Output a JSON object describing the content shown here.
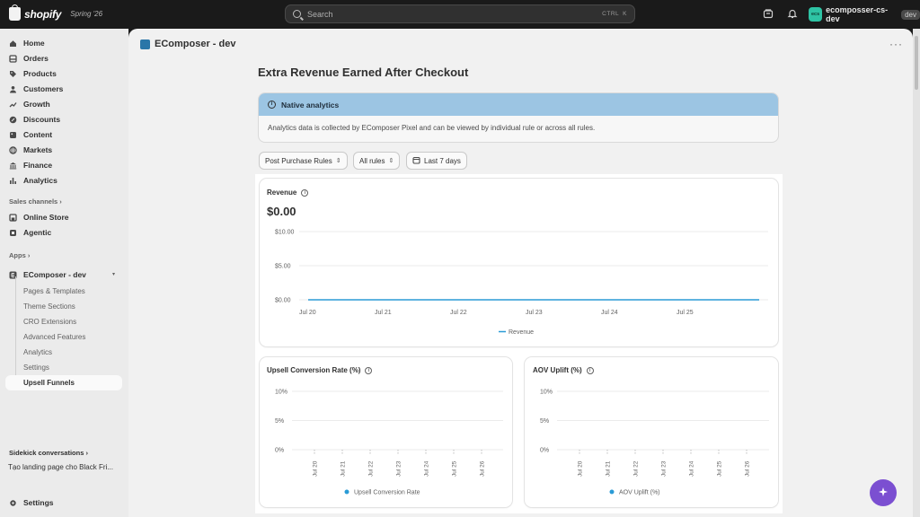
{
  "topbar": {
    "brand": "shopify",
    "edition": "Spring '26",
    "search_placeholder": "Search",
    "shortcut_ctrl": "CTRL",
    "shortcut_key": "K",
    "store_initials": "ecs",
    "store_name": "ecomposser-cs-dev",
    "store_badge": "dev"
  },
  "sidebar": {
    "items": [
      {
        "label": "Home",
        "icon": "home-icon"
      },
      {
        "label": "Orders",
        "icon": "orders-icon"
      },
      {
        "label": "Products",
        "icon": "tag-icon"
      },
      {
        "label": "Customers",
        "icon": "person-icon"
      },
      {
        "label": "Growth",
        "icon": "growth-icon"
      },
      {
        "label": "Discounts",
        "icon": "discount-icon"
      },
      {
        "label": "Content",
        "icon": "content-icon"
      },
      {
        "label": "Markets",
        "icon": "globe-icon"
      },
      {
        "label": "Finance",
        "icon": "bank-icon"
      },
      {
        "label": "Analytics",
        "icon": "bar-chart-icon"
      }
    ],
    "sales_channels_label": "Sales channels",
    "channels": [
      {
        "label": "Online Store"
      },
      {
        "label": "Agentic"
      }
    ],
    "apps_label": "Apps",
    "app_name": "EComposer - dev",
    "app_sub_items": [
      "Pages & Templates",
      "Theme Sections",
      "CRO Extensions",
      "Advanced Features",
      "Analytics",
      "Settings"
    ],
    "active_sub_item": "Upsell Funnels",
    "sidekick_label": "Sidekick conversations",
    "sidekick_item": "Tạo landing page cho Black Fri...",
    "settings_label": "Settings"
  },
  "header": {
    "app_title": "EComposer - dev",
    "more": "···"
  },
  "page": {
    "title": "Extra Revenue Earned After Checkout",
    "banner_title": "Native analytics",
    "banner_text": "Analytics data is collected by EComposer Pixel and can be viewed by individual rule or across all rules.",
    "filters": {
      "rule_type": "Post Purchase Rules",
      "rules": "All rules",
      "date_range": "Last 7 days"
    }
  },
  "chart_data": [
    {
      "type": "line",
      "title": "Revenue",
      "total": "$0.00",
      "categories": [
        "Jul 20",
        "Jul 21",
        "Jul 22",
        "Jul 23",
        "Jul 24",
        "Jul 25"
      ],
      "y_ticks": [
        "$10.00",
        "$5.00",
        "$0.00"
      ],
      "ylim": [
        0,
        10
      ],
      "series": [
        {
          "name": "Revenue",
          "values": [
            0,
            0,
            0,
            0,
            0,
            0,
            0
          ]
        }
      ],
      "color": "#2a9bd6",
      "legend": "bottom",
      "grid": true
    },
    {
      "type": "line",
      "title": "Upsell Conversion Rate (%)",
      "categories": [
        "Jul 20",
        "Jul 21",
        "Jul 22",
        "Jul 23",
        "Jul 24",
        "Jul 25",
        "Jul 26"
      ],
      "y_ticks": [
        "10%",
        "5%",
        "0%"
      ],
      "ylim": [
        0,
        10
      ],
      "series": [
        {
          "name": "Upsell Conversion Rate",
          "values": [
            0,
            0,
            0,
            0,
            0,
            0,
            0
          ]
        }
      ],
      "color": "#2a9bd6",
      "legend": "bottom",
      "grid": true
    },
    {
      "type": "line",
      "title": "AOV Uplift (%)",
      "categories": [
        "Jul 20",
        "Jul 21",
        "Jul 22",
        "Jul 23",
        "Jul 24",
        "Jul 25",
        "Jul 26"
      ],
      "y_ticks": [
        "10%",
        "5%",
        "0%"
      ],
      "ylim": [
        0,
        10
      ],
      "series": [
        {
          "name": "AOV Uplift (%)",
          "values": [
            0,
            0,
            0,
            0,
            0,
            0,
            0
          ]
        }
      ],
      "color": "#2a9bd6",
      "legend": "bottom",
      "grid": true
    }
  ]
}
